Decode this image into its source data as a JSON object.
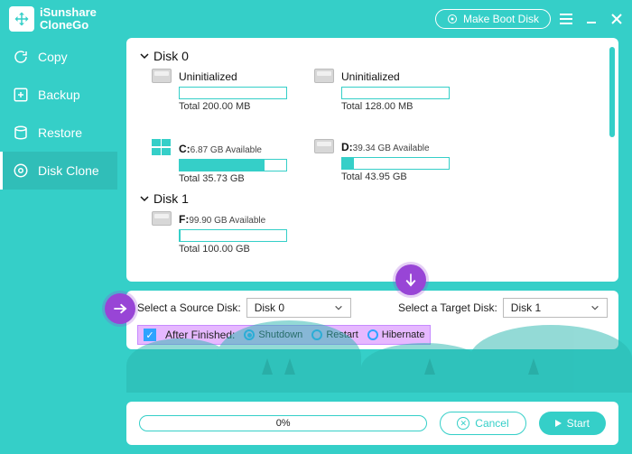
{
  "app": {
    "brand_line1": "iSunshare",
    "brand_line2": "CloneGo"
  },
  "titlebar": {
    "boot_label": "Make Boot Disk"
  },
  "sidebar": {
    "items": [
      {
        "label": "Copy"
      },
      {
        "label": "Backup"
      },
      {
        "label": "Restore"
      },
      {
        "label": "Disk Clone"
      }
    ]
  },
  "disks": [
    {
      "name": "Disk 0",
      "partitions": [
        {
          "label": "Uninitialized",
          "avail": "",
          "total": "Total 200.00 MB",
          "fill_pct": 0,
          "os": false
        },
        {
          "label": "Uninitialized",
          "avail": "",
          "total": "Total 128.00 MB",
          "fill_pct": 0,
          "os": false
        },
        {
          "label": "C:",
          "avail": "6.87 GB Available",
          "total": "Total 35.73 GB",
          "fill_pct": 80,
          "os": true
        },
        {
          "label": "D:",
          "avail": "39.34 GB Available",
          "total": "Total 43.95 GB",
          "fill_pct": 11,
          "os": false
        }
      ]
    },
    {
      "name": "Disk 1",
      "partitions": [
        {
          "label": "F:",
          "avail": "99.90 GB Available",
          "total": "Total 100.00 GB",
          "fill_pct": 1,
          "os": false
        }
      ]
    }
  ],
  "controls": {
    "source_label": "Select a Source Disk:",
    "source_value": "Disk 0",
    "target_label": "Select a Target Disk:",
    "target_value": "Disk 1",
    "after_label": "After Finished:",
    "options": {
      "shutdown": "Shutdown",
      "restart": "Restart",
      "hibernate": "Hibernate"
    },
    "after_checked": true,
    "selected_option": "shutdown"
  },
  "footer": {
    "progress_text": "0%",
    "cancel": "Cancel",
    "start": "Start"
  }
}
